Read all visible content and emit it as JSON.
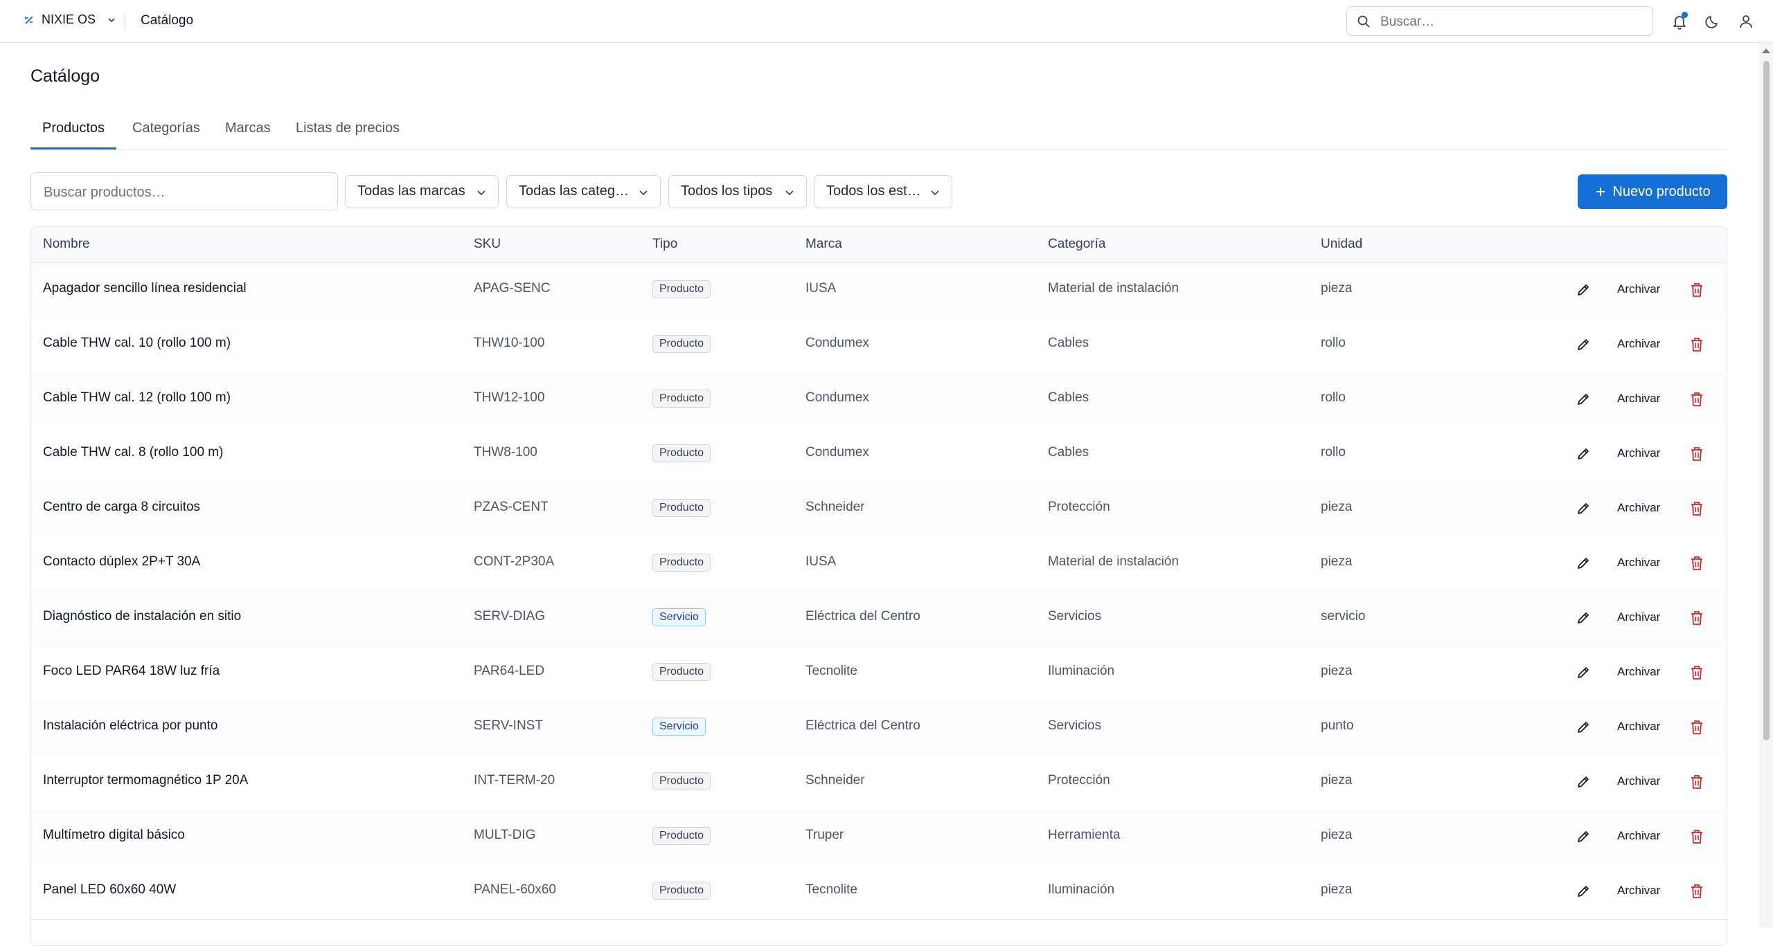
{
  "topbar": {
    "brand": "NIXIE OS",
    "breadcrumb": "Catálogo",
    "search_placeholder": "Buscar…",
    "notification_dot_color": "#1570d6"
  },
  "page": {
    "title": "Catálogo"
  },
  "tabs": [
    {
      "label": "Productos",
      "active": true
    },
    {
      "label": "Categorías",
      "active": false
    },
    {
      "label": "Marcas",
      "active": false
    },
    {
      "label": "Listas de precios",
      "active": false
    }
  ],
  "filters": {
    "search_placeholder": "Buscar productos…",
    "brand": "Todas las marcas",
    "category": "Todas las categ…",
    "type": "Todos los tipos",
    "status": "Todos los est…",
    "new_button": "Nuevo producto"
  },
  "table": {
    "columns": [
      "Nombre",
      "SKU",
      "Tipo",
      "Marca",
      "Categoría",
      "Unidad"
    ],
    "archive_label": "Archivar",
    "rows": [
      {
        "name": "Apagador sencillo línea residencial",
        "sku": "APAG-SENC",
        "type": "Producto",
        "brand": "IUSA",
        "category": "Material de instalación",
        "unit": "pieza"
      },
      {
        "name": "Cable THW cal. 10 (rollo 100 m)",
        "sku": "THW10-100",
        "type": "Producto",
        "brand": "Condumex",
        "category": "Cables",
        "unit": "rollo"
      },
      {
        "name": "Cable THW cal. 12 (rollo 100 m)",
        "sku": "THW12-100",
        "type": "Producto",
        "brand": "Condumex",
        "category": "Cables",
        "unit": "rollo"
      },
      {
        "name": "Cable THW cal. 8 (rollo 100 m)",
        "sku": "THW8-100",
        "type": "Producto",
        "brand": "Condumex",
        "category": "Cables",
        "unit": "rollo"
      },
      {
        "name": "Centro de carga 8 circuitos",
        "sku": "PZAS-CENT",
        "type": "Producto",
        "brand": "Schneider",
        "category": "Protección",
        "unit": "pieza"
      },
      {
        "name": "Contacto dúplex 2P+T 30A",
        "sku": "CONT-2P30A",
        "type": "Producto",
        "brand": "IUSA",
        "category": "Material de instalación",
        "unit": "pieza"
      },
      {
        "name": "Diagnóstico de instalación en sitio",
        "sku": "SERV-DIAG",
        "type": "Servicio",
        "brand": "Eléctrica del Centro",
        "category": "Servicios",
        "unit": "servicio"
      },
      {
        "name": "Foco LED PAR64 18W luz fría",
        "sku": "PAR64-LED",
        "type": "Producto",
        "brand": "Tecnolite",
        "category": "Iluminación",
        "unit": "pieza"
      },
      {
        "name": "Instalación eléctrica por punto",
        "sku": "SERV-INST",
        "type": "Servicio",
        "brand": "Eléctrica del Centro",
        "category": "Servicios",
        "unit": "punto"
      },
      {
        "name": "Interruptor termomagnético 1P 20A",
        "sku": "INT-TERM-20",
        "type": "Producto",
        "brand": "Schneider",
        "category": "Protección",
        "unit": "pieza"
      },
      {
        "name": "Multímetro digital básico",
        "sku": "MULT-DIG",
        "type": "Producto",
        "brand": "Truper",
        "category": "Herramienta",
        "unit": "pieza"
      },
      {
        "name": "Panel LED 60x60 40W",
        "sku": "PANEL-60x60",
        "type": "Producto",
        "brand": "Tecnolite",
        "category": "Iluminación",
        "unit": "pieza"
      }
    ]
  },
  "colors": {
    "accent": "#1570d6",
    "delete": "#dc2626"
  }
}
